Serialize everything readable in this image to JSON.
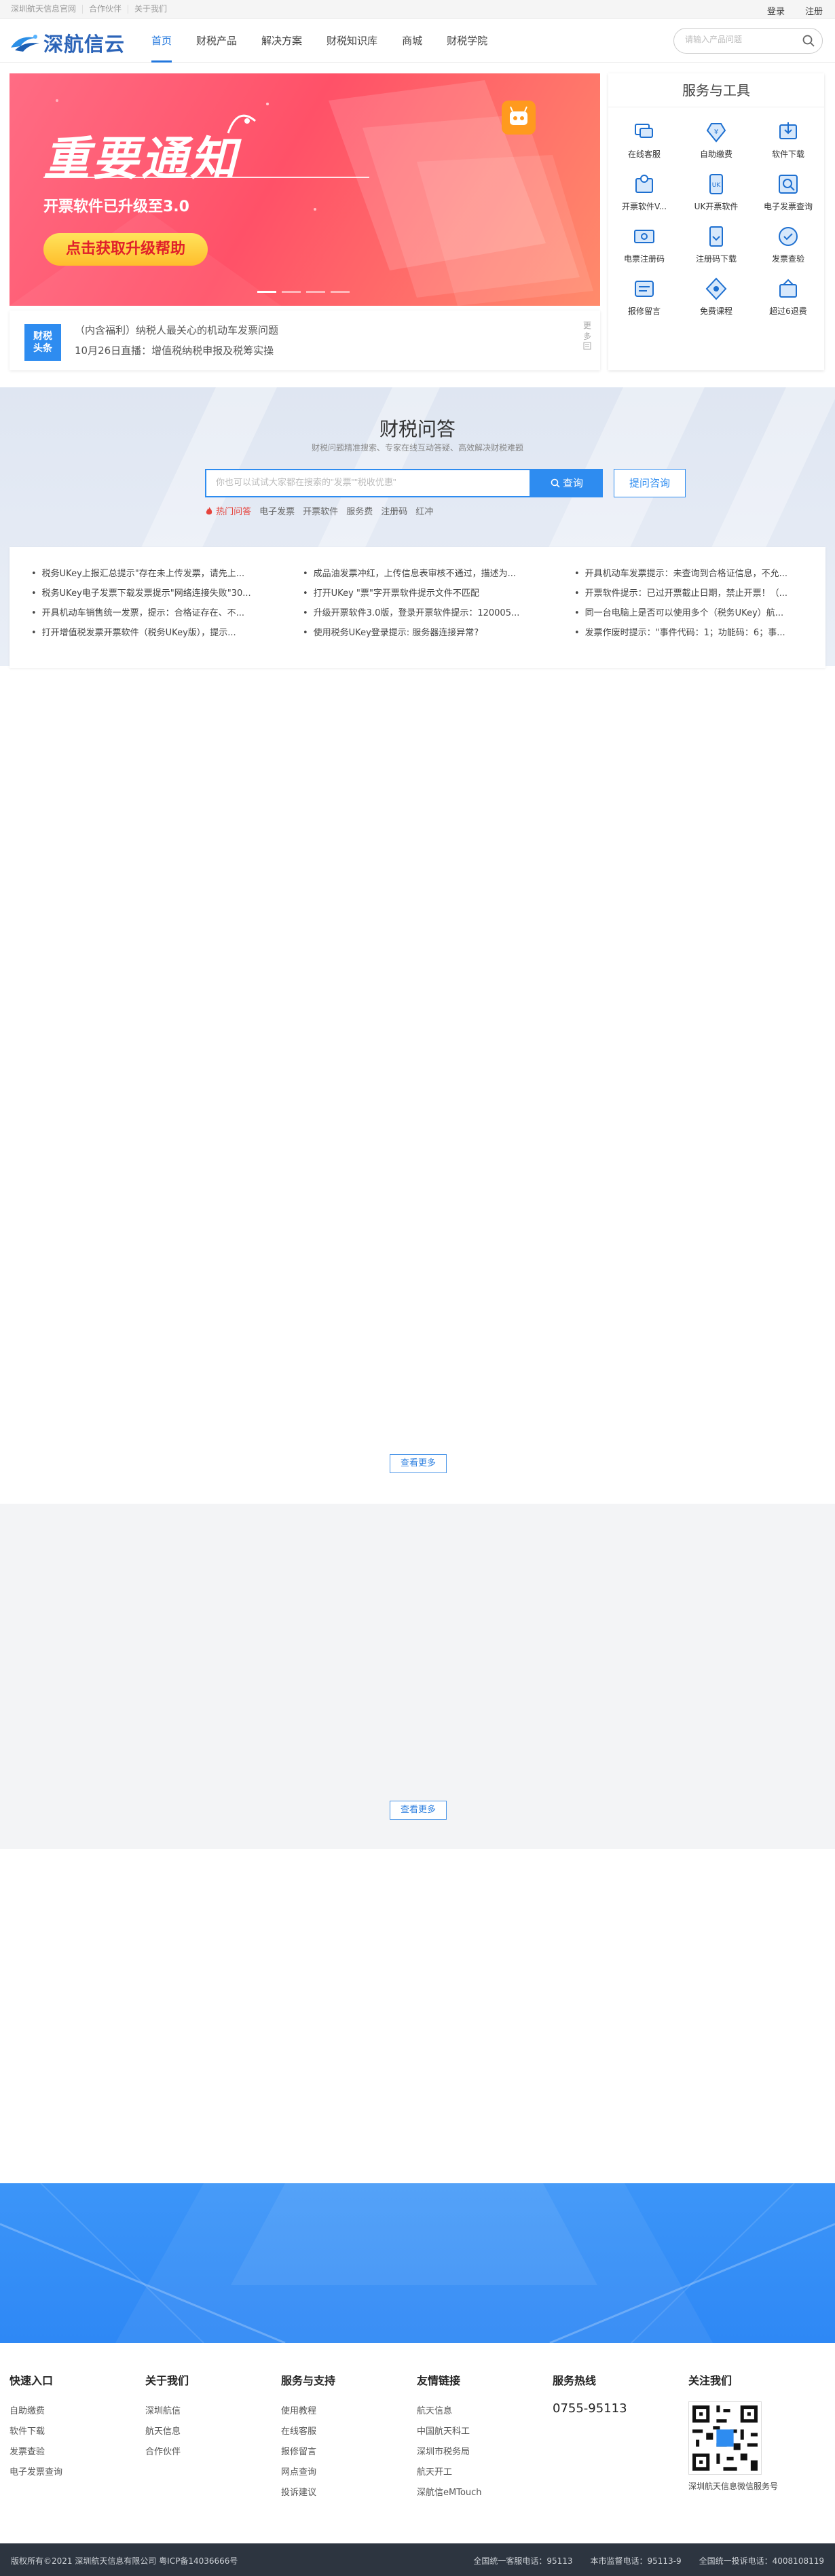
{
  "topbar": {
    "links": [
      "深圳航天信息官网",
      "合作伙伴",
      "关于我们"
    ],
    "login": "登录",
    "register": "注册"
  },
  "header": {
    "logo_text": "深航信云",
    "nav": [
      "首页",
      "财税产品",
      "解决方案",
      "财税知识库",
      "商城",
      "财税学院"
    ],
    "active_nav": "首页",
    "search_placeholder": "请输入产品问题"
  },
  "banner": {
    "title": "重要通知",
    "subtitle": "开票软件已升级至3.0",
    "cta": "点击获取升级帮助",
    "slide_count": 4,
    "active_slide": 1
  },
  "headline": {
    "badge": [
      "财税",
      "头条"
    ],
    "items": [
      "（内含福利）纳税人最关心的机动车发票问题",
      "10月26日直播：增值税纳税申报及税筹实操"
    ],
    "more": "更多"
  },
  "tools": {
    "title": "服务与工具",
    "items": [
      {
        "label": "在线客服",
        "icon": "chat-icon"
      },
      {
        "label": "自助缴费",
        "icon": "payment-icon"
      },
      {
        "label": "软件下载",
        "icon": "download-icon"
      },
      {
        "label": "开票软件V...",
        "icon": "invoice-software-icon"
      },
      {
        "label": "UK开票软件",
        "icon": "ukey-icon"
      },
      {
        "label": "电子发票查询",
        "icon": "einvoice-search-icon"
      },
      {
        "label": "电票注册码",
        "icon": "register-code-icon"
      },
      {
        "label": "注册码下载",
        "icon": "code-download-icon"
      },
      {
        "label": "发票查验",
        "icon": "invoice-verify-icon"
      },
      {
        "label": "报修留言",
        "icon": "repair-message-icon"
      },
      {
        "label": "免费课程",
        "icon": "free-course-icon"
      },
      {
        "label": "超过6退费",
        "icon": "refund-icon"
      }
    ]
  },
  "qa": {
    "title": "财税问答",
    "subtitle": "财税问题精准搜索、专家在线互动答疑、高效解决财税难题",
    "search_placeholder": "你也可以试试大家都在搜索的\"发票\"\"税收优惠\"",
    "query_button": "查询",
    "ask_button": "提问咨询",
    "hot_label": "热门问答",
    "hot_tags": [
      "电子发票",
      "开票软件",
      "服务费",
      "注册码",
      "红冲"
    ],
    "columns": [
      [
        "税务UKey上报汇总提示\"存在未上传发票，请先上...",
        "税务UKey电子发票下载发票提示\"网络连接失败\"30...",
        "开具机动车销售统一发票，提示：合格证存在、不...",
        "打开增值税发票开票软件（税务UKey版），提示..."
      ],
      [
        "成品油发票冲红，上传信息表审核不通过，描述为...",
        "打开UKey \"票\"字开票软件提示文件不匹配",
        "升级开票软件3.0版，登录开票软件提示：120005...",
        "使用税务UKey登录提示: 服务器连接异常?"
      ],
      [
        "开具机动车发票提示：未查询到合格证信息，不允...",
        "开票软件提示：已过开票截止日期，禁止开票！（...",
        "同一台电脑上是否可以使用多个（税务UKey）航...",
        "发票作废时提示：\"事件代码：1；功能码：6；事..."
      ]
    ],
    "more_button": "查看更多"
  },
  "section2": {
    "more_button": "查看更多"
  },
  "footer": {
    "columns": [
      {
        "title": "快速入口",
        "links": [
          "自助缴费",
          "软件下载",
          "发票查验",
          "电子发票查询"
        ]
      },
      {
        "title": "关于我们",
        "links": [
          "深圳航信",
          "航天信息",
          "合作伙伴"
        ]
      },
      {
        "title": "服务与支持",
        "links": [
          "使用教程",
          "在线客服",
          "报修留言",
          "网点查询",
          "投诉建议"
        ]
      },
      {
        "title": "友情链接",
        "links": [
          "航天信息",
          "中国航天科工",
          "深圳市税务局",
          "航天开工",
          "深航信eMTouch"
        ]
      }
    ],
    "hotline_title": "服务热线",
    "hotline": "0755-95113",
    "follow_title": "关注我们",
    "qr_caption": "深圳航天信息微信服务号"
  },
  "copyright": {
    "left": "版权所有©2021 深圳航天信息有限公司 粤ICP备14036666号",
    "right": [
      "全国统一客服电话：95113",
      "本市监督电话：95113-9",
      "全国统一投诉电话：4008108119"
    ]
  },
  "colors": {
    "accent": "#2e8cf0",
    "banner": "#ff5168",
    "cta": "#ffc93a",
    "footer_bar": "#2d3540"
  }
}
